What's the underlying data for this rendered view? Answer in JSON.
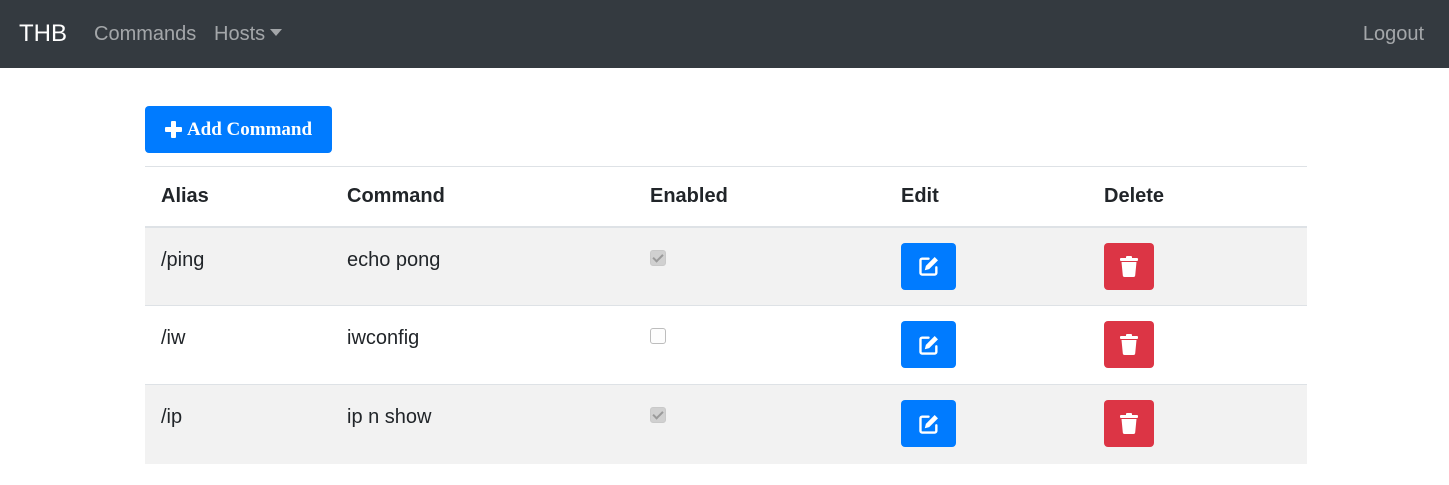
{
  "navbar": {
    "brand": "THB",
    "links": {
      "commands": "Commands",
      "hosts": "Hosts",
      "logout": "Logout"
    }
  },
  "toolbar": {
    "add_label": "Add Command",
    "add_icon": "plus-icon"
  },
  "table": {
    "headers": [
      "Alias",
      "Command",
      "Enabled",
      "Edit",
      "Delete"
    ],
    "rows": [
      {
        "alias": "/ping",
        "command": "echo pong",
        "enabled": true
      },
      {
        "alias": "/iw",
        "command": "iwconfig",
        "enabled": false
      },
      {
        "alias": "/ip",
        "command": "ip n show",
        "enabled": true
      }
    ],
    "edit_icon": "edit-icon",
    "delete_icon": "trash-icon"
  },
  "colors": {
    "navbar": "#343a40",
    "primary": "#007bff",
    "danger": "#dc3545",
    "stripe": "#f2f2f2"
  }
}
